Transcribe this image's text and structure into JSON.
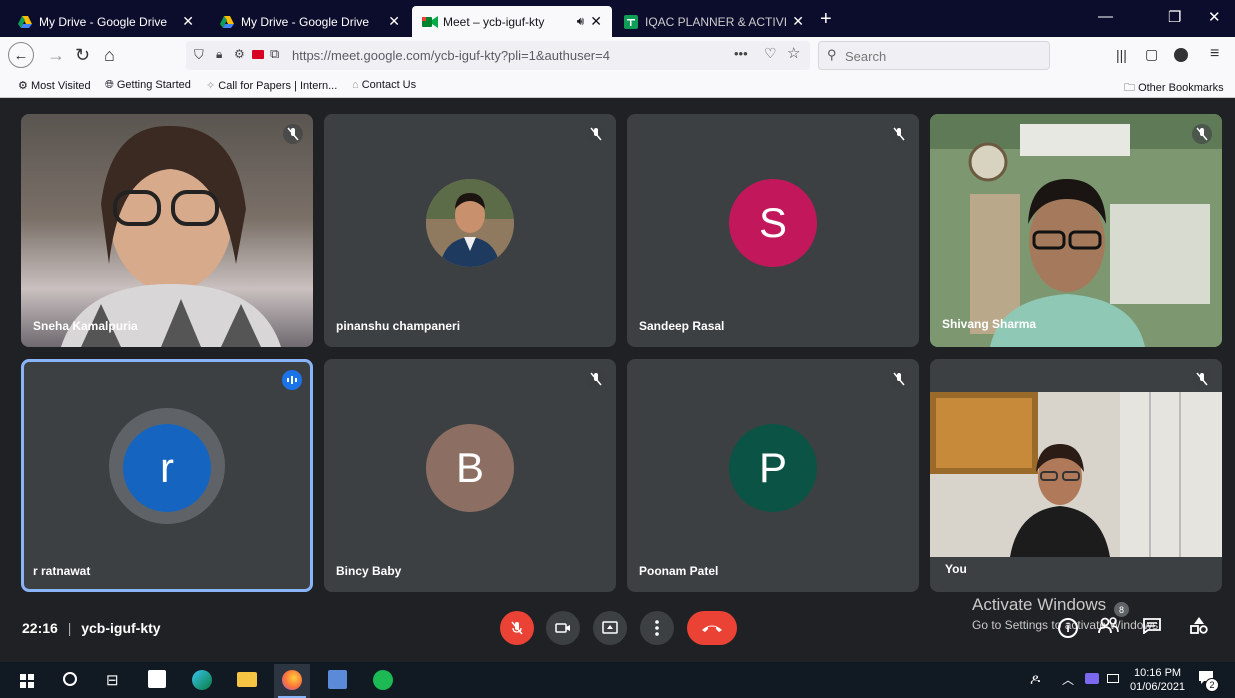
{
  "tabs": [
    {
      "title": "My Drive - Google Drive",
      "active": false
    },
    {
      "title": "My Drive - Google Drive",
      "active": false
    },
    {
      "title": "Meet – ycb-iguf-kty",
      "active": true
    },
    {
      "title": "IQAC PLANNER & ACTIVITIES - ",
      "active": false
    }
  ],
  "nav": {
    "url": "https://meet.google.com/ycb-iguf-kty?pli=1&authuser=4",
    "search_placeholder": "Search",
    "more": "•••"
  },
  "bookmarks": {
    "items": [
      "Most Visited",
      "Getting Started",
      "Call for Papers | Intern...",
      "Contact Us"
    ],
    "other": "Other Bookmarks"
  },
  "participants": [
    {
      "name": "Sneha Kamalpuria",
      "type": "video",
      "muted": true
    },
    {
      "name": "pinanshu champaneri",
      "type": "photo",
      "muted": true
    },
    {
      "name": "Sandeep Rasal",
      "type": "letter",
      "letter": "S",
      "color": "#c2185b",
      "muted": true
    },
    {
      "name": "Shivang Sharma",
      "type": "video",
      "muted": true
    },
    {
      "name": "r ratnawat",
      "type": "letter",
      "letter": "r",
      "color": "#1565c0",
      "muted": false,
      "speaking": true
    },
    {
      "name": "Bincy Baby",
      "type": "letter",
      "letter": "B",
      "color": "#8d6e63",
      "muted": true
    },
    {
      "name": "Poonam Patel",
      "type": "letter",
      "letter": "P",
      "color": "#0b5345",
      "muted": true
    },
    {
      "name": "You",
      "type": "video",
      "muted": true
    }
  ],
  "meeting": {
    "time": "22:16",
    "separator": "|",
    "code": "ycb-iguf-kty",
    "participant_count": "8"
  },
  "activation": {
    "title": "Activate Windows",
    "subtitle": "Go to Settings to activate Windows."
  },
  "taskbar": {
    "time": "10:16 PM",
    "date": "01/06/2021",
    "notif_count": "2"
  },
  "colors": {
    "accent": "#8ab4f8",
    "end_call": "#ea4335",
    "tile_bg": "#3c4043",
    "meet_bg": "#202124"
  }
}
